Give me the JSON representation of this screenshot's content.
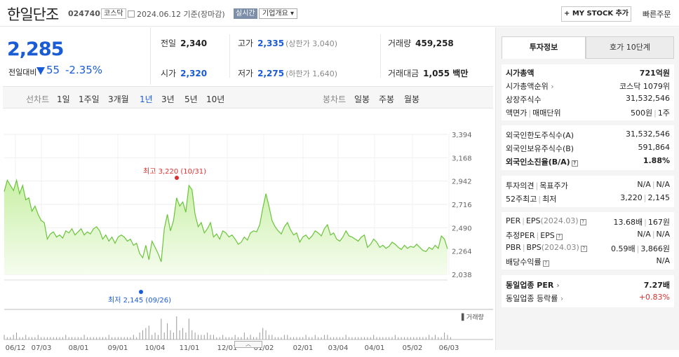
{
  "header": {
    "stock_name": "한일단조",
    "stock_code": "024740",
    "market_badge": "코스닥",
    "date": "2024.06.12",
    "date_note": "기준(장마감)",
    "live_badge": "실시간",
    "company_info": "기업개요",
    "company_info_chevron": "▾",
    "mystock_label": "+ MY STOCK 추가",
    "quick_order": "빠른주문"
  },
  "price": {
    "current": "2,285",
    "vs_label": "전일대비",
    "change": "55",
    "rate": "-2.35%",
    "colors": {
      "down": "#1a5bd6",
      "up": "#d8312f"
    }
  },
  "quote": {
    "prev_close": {
      "label": "전일",
      "value": "2,340"
    },
    "high": {
      "label": "고가",
      "value": "2,335",
      "sub": "(상한가 3,040)"
    },
    "volume": {
      "label": "거래량",
      "value": "459,258"
    },
    "open": {
      "label": "시가",
      "value": "2,320"
    },
    "low": {
      "label": "저가",
      "value": "2,275",
      "sub": "(하한가 1,640)"
    },
    "amount": {
      "label": "거래대금",
      "value": "1,055 백만"
    }
  },
  "periods": {
    "line_label": "선차트",
    "line_options": [
      "1일",
      "1주일",
      "3개월",
      "1년",
      "3년",
      "5년",
      "10년"
    ],
    "active": "1년",
    "candle_label": "봉차트",
    "candle_options": [
      "일봉",
      "주봉",
      "월봉"
    ]
  },
  "chart_data": {
    "type": "area",
    "ylim": [
      2038,
      3394
    ],
    "yticks": [
      "3,394",
      "3,168",
      "2,942",
      "2,716",
      "2,490",
      "2,264",
      "2,038"
    ],
    "xticks": [
      "06/12",
      "07/03",
      "08/01",
      "09/01",
      "10/04",
      "11/01",
      "12/01",
      "01/02",
      "02/01",
      "03/04",
      "04/01",
      "05/02",
      "06/03"
    ],
    "volume_label": "▌거래량",
    "annotation_high": "최고 3,220 (10/31)",
    "annotation_low": "최저 2,145 (09/26)",
    "values": [
      2840,
      2950,
      2900,
      2850,
      2950,
      2820,
      2900,
      2760,
      2780,
      2650,
      2700,
      2620,
      2560,
      2540,
      2380,
      2430,
      2450,
      2400,
      2420,
      2390,
      2460,
      2440,
      2480,
      2420,
      2450,
      2480,
      2420,
      2450,
      2430,
      2480,
      2500,
      2460,
      2380,
      2420,
      2360,
      2400,
      2340,
      2400,
      2420,
      2400,
      2360,
      2380,
      2320,
      2340,
      2240,
      2200,
      2320,
      2180,
      2360,
      2300,
      2240,
      2160,
      2480,
      2620,
      2460,
      2560,
      2780,
      2700,
      2740,
      2640,
      2900,
      2860,
      2620,
      2500,
      2540,
      2440,
      2480,
      2540,
      2400,
      2430,
      2380,
      2460,
      2440,
      2400,
      2420,
      2380,
      2330,
      2350,
      2400,
      2370,
      2440,
      2460,
      2450,
      2520,
      2680,
      2820,
      2700,
      2560,
      2500,
      2460,
      2430,
      2500,
      2540,
      2470,
      2420,
      2440,
      2350,
      2400,
      2420,
      2380,
      2410,
      2460,
      2440,
      2410,
      2480,
      2520,
      2420,
      2440,
      2380,
      2360,
      2400,
      2460,
      2410,
      2400,
      2380,
      2360,
      2400,
      2420,
      2300,
      2330,
      2380,
      2350,
      2300,
      2320,
      2290,
      2310,
      2350,
      2330,
      2300,
      2280,
      2320,
      2290,
      2310,
      2300,
      2330,
      2300,
      2270,
      2260,
      2300,
      2280,
      2320,
      2290,
      2410,
      2380,
      2285
    ],
    "volumes": [
      2,
      1,
      1,
      2,
      3,
      1,
      1,
      2,
      1,
      1,
      1,
      2,
      1,
      1,
      1,
      1,
      1,
      1,
      1,
      1,
      2,
      1,
      1,
      1,
      1,
      1,
      2,
      1,
      1,
      1,
      1,
      1,
      1,
      1,
      2,
      1,
      1,
      1,
      1,
      1,
      1,
      1,
      2,
      1,
      3,
      4,
      5,
      6,
      2,
      3,
      2,
      9,
      3,
      7,
      4,
      3,
      10,
      4,
      5,
      3,
      9,
      4,
      3,
      2,
      2,
      2,
      3,
      2,
      2,
      1,
      1,
      2,
      1,
      1,
      1,
      2,
      1,
      1,
      3,
      1,
      2,
      1,
      1,
      3,
      5,
      4,
      2,
      2,
      1,
      1,
      1,
      2,
      2,
      1,
      1,
      1,
      1,
      1,
      2,
      1,
      1,
      2,
      1,
      1,
      2,
      2,
      1,
      1,
      1,
      1,
      1,
      2,
      1,
      1,
      1,
      1,
      1,
      1,
      1,
      1,
      2,
      1,
      1,
      1,
      1,
      1,
      1,
      2,
      1,
      1,
      1,
      1,
      1,
      1,
      1,
      1,
      1,
      1,
      2,
      1,
      2,
      1,
      1,
      3,
      2,
      1
    ]
  },
  "side": {
    "tab_invest": "투자정보",
    "tab_hoga": "호가 10단계",
    "market_cap_label": "시가총액",
    "market_cap_value": "721억원",
    "cap_rank_label": "시가총액순위",
    "cap_rank_value": "코스닥 1079위",
    "shares_label": "상장주식수",
    "shares_value": "31,532,546",
    "par_label": "액면가",
    "unit_label": "매매단위",
    "par_value": "500원",
    "unit_value": "1주",
    "foreign_limit_label": "외국인한도주식수(A)",
    "foreign_limit_value": "31,532,546",
    "foreign_hold_label": "외국인보유주식수(B)",
    "foreign_hold_value": "591,864",
    "foreign_rate_label": "외국인소진율(B/A)",
    "foreign_rate_value": "1.88%",
    "opinion_label": "투자의견",
    "target_label": "목표주가",
    "opinion_value": "N/A",
    "target_value": "N/A",
    "w52_high_label": "52주최고",
    "w52_low_label": "최저",
    "w52_high_value": "3,220",
    "w52_low_value": "2,145",
    "per_label": "PER",
    "eps_label": "EPS",
    "eps_period": "(2024.03)",
    "per_value": "13.68배",
    "eps_value": "167원",
    "est_per_label": "추정PER",
    "est_eps_label": "EPS",
    "est_per_value": "N/A",
    "est_eps_value": "N/A",
    "pbr_label": "PBR",
    "bps_label": "BPS",
    "bps_period": "(2024.03)",
    "pbr_value": "0.59배",
    "bps_value": "3,866원",
    "div_label": "배당수익률",
    "div_value": "N/A",
    "sector_per_label": "동일업종 PER",
    "sector_per_value": "7.27배",
    "sector_rate_label": "동일업종 등락률",
    "sector_rate_value": "+0.83%"
  },
  "handle_label": "︿"
}
